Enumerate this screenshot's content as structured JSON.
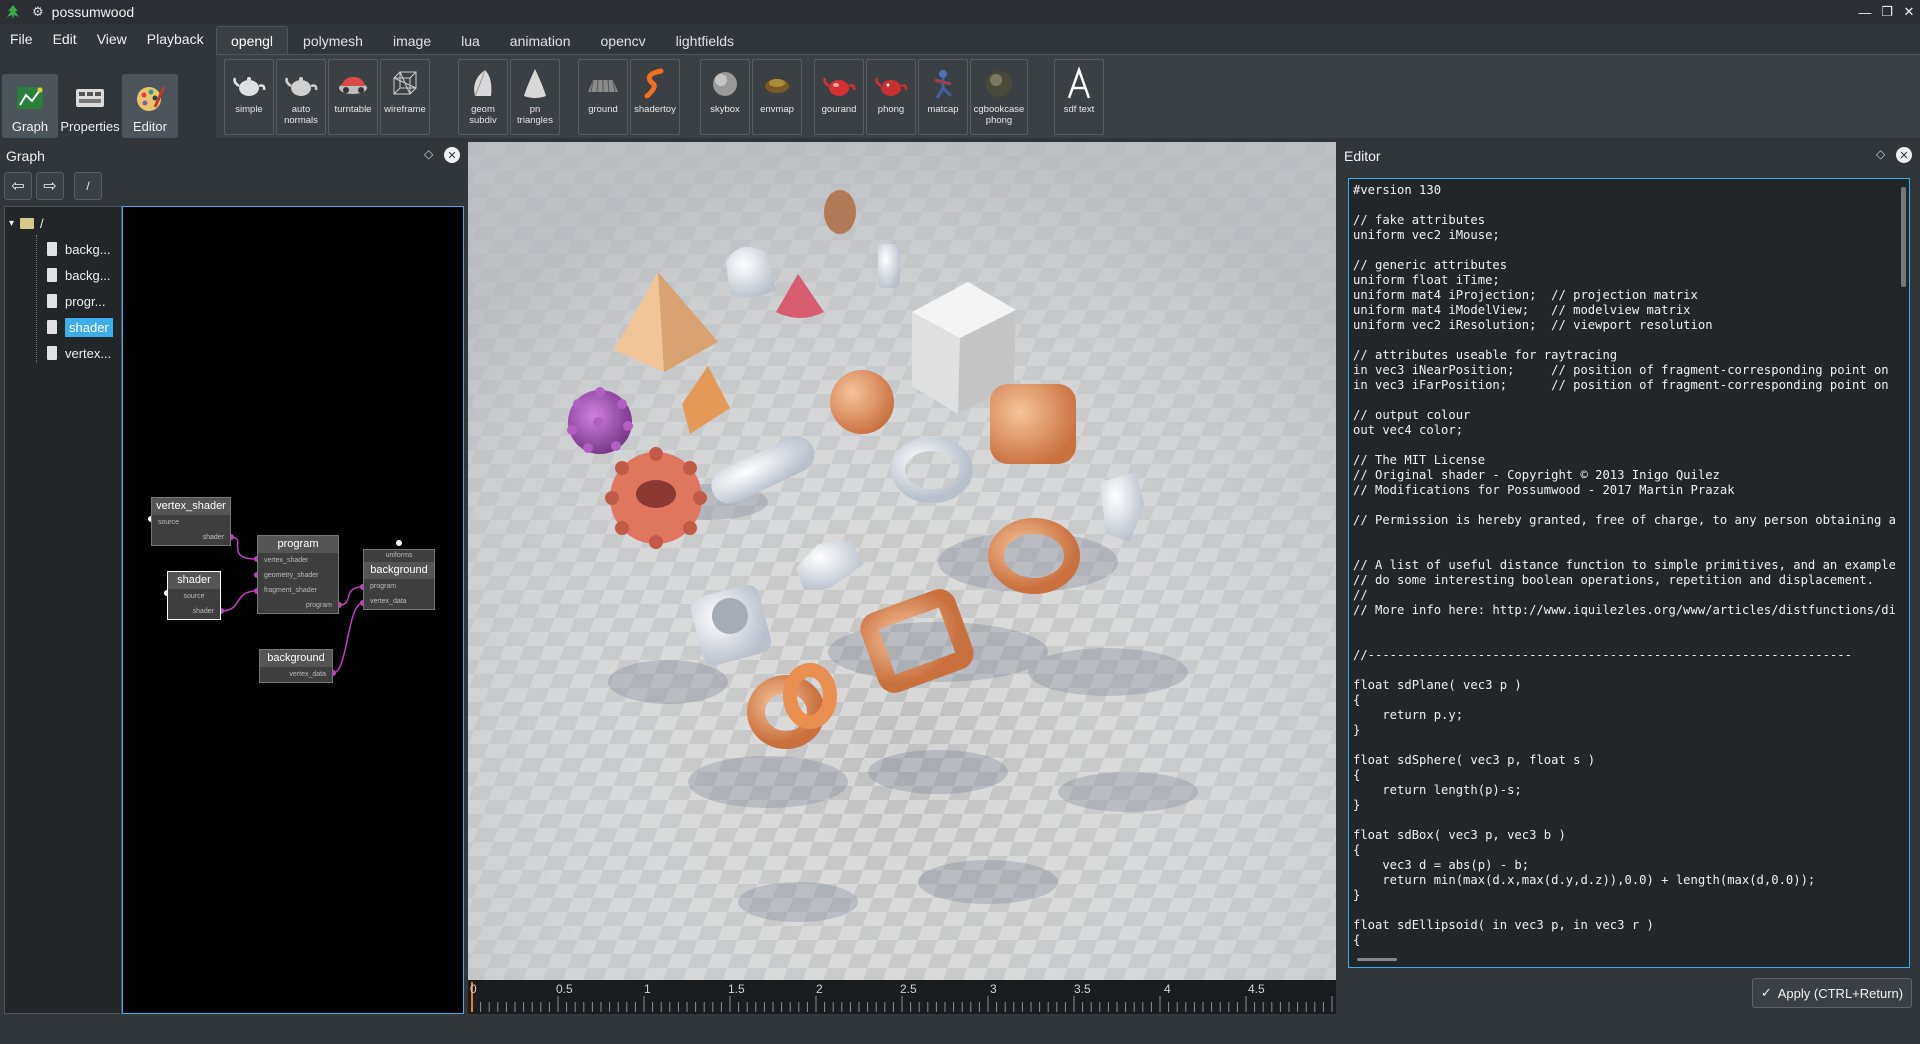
{
  "window": {
    "title": "possumwood"
  },
  "menu": [
    "File",
    "Edit",
    "View",
    "Playback"
  ],
  "tabs": [
    {
      "label": "opengl",
      "active": true
    },
    {
      "label": "polymesh",
      "active": false
    },
    {
      "label": "image",
      "active": false
    },
    {
      "label": "lua",
      "active": false
    },
    {
      "label": "animation",
      "active": false
    },
    {
      "label": "opencv",
      "active": false
    },
    {
      "label": "lightfields",
      "active": false
    }
  ],
  "left_tools": [
    {
      "label": "Graph",
      "icon": "graph-icon",
      "active": true
    },
    {
      "label": "Properties",
      "icon": "properties-icon",
      "active": false
    },
    {
      "label": "Editor",
      "icon": "editor-icon",
      "active": true
    }
  ],
  "toolbar": [
    {
      "label": "simple",
      "icon": "teapot-icon",
      "color": "#dddddd"
    },
    {
      "label": "auto normals",
      "icon": "teapot-icon",
      "color": "#cccccc"
    },
    {
      "label": "turntable",
      "icon": "car-icon",
      "color": "#e04a4a"
    },
    {
      "label": "wireframe",
      "icon": "wireframe-cube-icon",
      "color": "#bbbbbb"
    },
    {
      "label": "geom subdiv",
      "icon": "shell-icon",
      "color": "#d8d8d8"
    },
    {
      "label": "pn triangles",
      "icon": "cone-icon",
      "color": "#d8d8d8"
    },
    {
      "label": "ground",
      "icon": "ground-icon",
      "color": "#aaaaaa"
    },
    {
      "label": "shadertoy",
      "icon": "shadertoy-icon",
      "color": "#f07020"
    },
    {
      "label": "skybox",
      "icon": "sphere-icon",
      "color": "#bbbbbb"
    },
    {
      "label": "envmap",
      "icon": "envmap-icon",
      "color": "#8a6a2a"
    },
    {
      "label": "gourand",
      "icon": "teapot-icon",
      "color": "#d63030"
    },
    {
      "label": "phong",
      "icon": "teapot-icon",
      "color": "#c83030"
    },
    {
      "label": "matcap",
      "icon": "figure-icon",
      "color": "#4060a0"
    },
    {
      "label": "cgbookcase phong",
      "icon": "rock-icon",
      "color": "#6a6a5a"
    },
    {
      "label": "sdf text",
      "icon": "letter-a-icon",
      "color": "#ffffff"
    }
  ],
  "graph_panel": {
    "title": "Graph",
    "path": "/",
    "tree_root": "/",
    "tree_items": [
      {
        "label": "backg...",
        "selected": false
      },
      {
        "label": "backg...",
        "selected": false
      },
      {
        "label": "progr...",
        "selected": false
      },
      {
        "label": "shader",
        "selected": true
      },
      {
        "label": "vertex...",
        "selected": false
      }
    ],
    "nodes": {
      "vertex_shader": {
        "title": "vertex_shader",
        "ports": [
          "source",
          "shader"
        ]
      },
      "program": {
        "title": "program",
        "ports": [
          "vertex_shader",
          "geometry_shader",
          "fragment_shader",
          "program"
        ]
      },
      "shader": {
        "title": "shader",
        "ports": [
          "source",
          "shader"
        ]
      },
      "background_top": {
        "header": "uniforms",
        "title": "background",
        "ports": [
          "program",
          "vertex_data"
        ]
      },
      "background_bottom": {
        "title": "background",
        "ports": [
          "vertex_data"
        ]
      }
    }
  },
  "viewport": {
    "timeline_labels": [
      "0",
      "0.5",
      "1",
      "1.5",
      "2",
      "2.5",
      "3",
      "3.5",
      "4",
      "4.5"
    ]
  },
  "editor": {
    "title": "Editor",
    "code": "#version 130\n\n// fake attributes\nuniform vec2 iMouse;\n\n// generic attributes\nuniform float iTime;\nuniform mat4 iProjection;  // projection matrix\nuniform mat4 iModelView;   // modelview matrix\nuniform vec2 iResolution;  // viewport resolution\n\n// attributes useable for raytracing\nin vec3 iNearPosition;     // position of fragment-corresponding point on n\nin vec3 iFarPosition;      // position of fragment-corresponding point on f\n\n// output colour\nout vec4 color;\n\n// The MIT License\n// Original shader - Copyright © 2013 Inigo Quilez\n// Modifications for Possumwood - 2017 Martin Prazak\n\n// Permission is hereby granted, free of charge, to any person obtaining a\n\n\n// A list of useful distance function to simple primitives, and an example\n// do some interesting boolean operations, repetition and displacement.\n//\n// More info here: http://www.iquilezles.org/www/articles/distfunctions/dis\n\n\n//------------------------------------------------------------------\n\nfloat sdPlane( vec3 p )\n{\n    return p.y;\n}\n\nfloat sdSphere( vec3 p, float s )\n{\n    return length(p)-s;\n}\n\nfloat sdBox( vec3 p, vec3 b )\n{\n    vec3 d = abs(p) - b;\n    return min(max(d.x,max(d.y,d.z)),0.0) + length(max(d,0.0));\n}\n\nfloat sdEllipsoid( in vec3 p, in vec3 r )\n{",
    "apply_label": "Apply (CTRL+Return)"
  },
  "colors": {
    "accent": "#3daee9",
    "background": "#31363b",
    "port": "#c040c0"
  }
}
